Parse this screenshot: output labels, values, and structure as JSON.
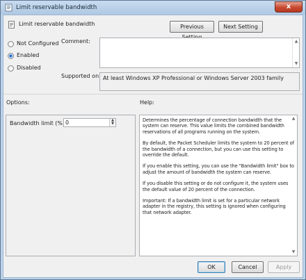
{
  "window": {
    "title": "Limit reservable bandwidth",
    "close_glyph": "x"
  },
  "header": {
    "title": "Limit reservable bandwidth",
    "previous_label": "Previous Setting",
    "next_label": "Next Setting"
  },
  "state": {
    "options": [
      {
        "label": "Not Configured",
        "checked": false
      },
      {
        "label": "Enabled",
        "checked": true
      },
      {
        "label": "Disabled",
        "checked": false
      }
    ]
  },
  "comment": {
    "label": "Comment:",
    "value": ""
  },
  "supported": {
    "label": "Supported on:",
    "value": "At least Windows XP Professional or Windows Server 2003 family"
  },
  "options_section": {
    "label": "Options:",
    "bandwidth_label": "Bandwidth limit (%):",
    "bandwidth_value": "0"
  },
  "help_section": {
    "label": "Help:",
    "paragraphs": [
      "Determines the percentage of connection bandwidth that the system can reserve. This value limits the combined bandwidth reservations of all programs running on the system.",
      "By default, the Packet Scheduler limits the system to 20 percent of the bandwidth of a connection, but you can use this setting to override the default.",
      "If you enable this setting, you can use the \"Bandwidth limit\" box to adjust the amount of bandwidth the system can reserve.",
      "If you disable this setting or do not configure it, the system uses the default value of 20 percent of the connection.",
      "Important: If a bandwidth limit is set for a particular network adapter in the registry, this setting is ignored when configuring that network adapter."
    ]
  },
  "footer": {
    "ok_label": "OK",
    "cancel_label": "Cancel",
    "apply_label": "Apply"
  },
  "colors": {
    "frame": "#bcd3ea",
    "close_button": "#c7492f",
    "dialog_bg": "#f0f0f0"
  },
  "icons": {
    "title": "policy-setting-icon",
    "header": "policy-setting-icon"
  }
}
